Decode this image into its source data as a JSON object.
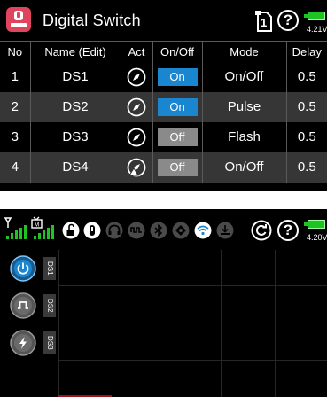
{
  "top_screen": {
    "title": "Digital Switch",
    "battery": {
      "voltage": "4.21V",
      "color": "#1ec324"
    },
    "icons": {
      "app": "switch-app-icon",
      "model": "model-1-icon",
      "help": "help-icon",
      "battery": "battery-icon"
    },
    "model_number": "1",
    "help_glyph": "?",
    "table": {
      "headers": [
        "No",
        "Name (Edit)",
        "Act",
        "On/Off",
        "Mode",
        "Delay"
      ],
      "rows": [
        {
          "no": "1",
          "name": "DS1",
          "act_icon": "compass-icon",
          "state": "On",
          "mode": "On/Off",
          "delay": "0.5"
        },
        {
          "no": "2",
          "name": "DS2",
          "act_icon": "compass-icon",
          "state": "On",
          "mode": "Pulse",
          "delay": "0.5"
        },
        {
          "no": "3",
          "name": "DS3",
          "act_icon": "compass-icon",
          "state": "Off",
          "mode": "Flash",
          "delay": "0.5"
        },
        {
          "no": "4",
          "name": "DS4",
          "act_icon": "compass-warning-icon",
          "state": "Off",
          "mode": "On/Off",
          "delay": "0.5"
        }
      ]
    },
    "colors": {
      "on": "#1a86d0",
      "off": "#8a8a8a",
      "accent": "#e0455f"
    }
  },
  "bottom_screen": {
    "battery": {
      "voltage": "4.20V"
    },
    "status_icons": [
      "antenna-signal-icon",
      "tv-signal-icon",
      "lock-icon",
      "power-icon",
      "headset-icon",
      "pulse-icon",
      "bluetooth-icon",
      "telemetry-icon",
      "wifi-icon",
      "download-icon",
      "refresh-icon",
      "help-icon"
    ],
    "help_glyph": "?",
    "switches": [
      {
        "label": "DS1",
        "icon": "power-icon",
        "active": true
      },
      {
        "label": "DS2",
        "icon": "pulse-wave-icon",
        "active": false
      },
      {
        "label": "DS3",
        "icon": "flash-icon",
        "active": false
      }
    ]
  }
}
